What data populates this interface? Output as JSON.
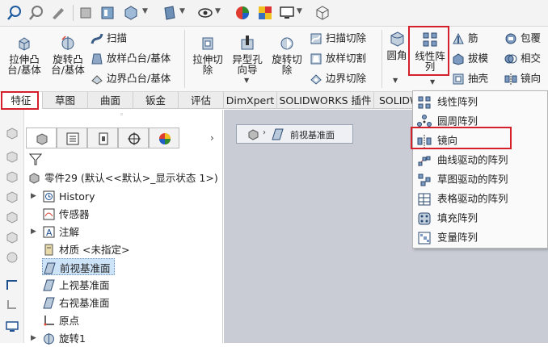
{
  "ribbon": {
    "extrude_boss": "拉伸凸\n台/基体",
    "revolve_boss": "旋转凸\n台/基体",
    "sweep": "扫描",
    "loft_boss": "放样凸台/基体",
    "boundary_boss": "边界凸台/基体",
    "extrude_cut": "拉伸切\n除",
    "hole_wizard": "异型孔\n向导",
    "revolve_cut": "旋转切\n除",
    "sweep_cut": "扫描切除",
    "loft_cut": "放样切割",
    "boundary_cut": "边界切除",
    "fillet": "圆角",
    "linear_pattern": "线性阵\n列",
    "rib": "筋",
    "draft": "拔模",
    "shell": "抽壳",
    "wrap": "包覆",
    "intersect": "相交",
    "mirror": "镜向"
  },
  "tabs": [
    "特征",
    "草图",
    "曲面",
    "钣金",
    "评估",
    "DimXpert",
    "SOLIDWORKS 插件",
    "SOLIDW"
  ],
  "tree": {
    "part": "零件29 (默认<<默认>_显示状态 1>)",
    "items": [
      "History",
      "传感器",
      "注解",
      "材质 <未指定>",
      "前视基准面",
      "上视基准面",
      "右视基准面",
      "原点",
      "旋转1"
    ]
  },
  "breadcrumb": {
    "label": "前视基准面"
  },
  "dropdown": {
    "items": [
      "线性阵列",
      "圆周阵列",
      "镜向",
      "曲线驱动的阵列",
      "草图驱动的阵列",
      "表格驱动的阵列",
      "填充阵列",
      "变量阵列"
    ]
  },
  "colors": {
    "highlight_red": "#d4202a",
    "selected_bg": "#cde3f7",
    "gfx_bg": "#c9ccd5"
  }
}
